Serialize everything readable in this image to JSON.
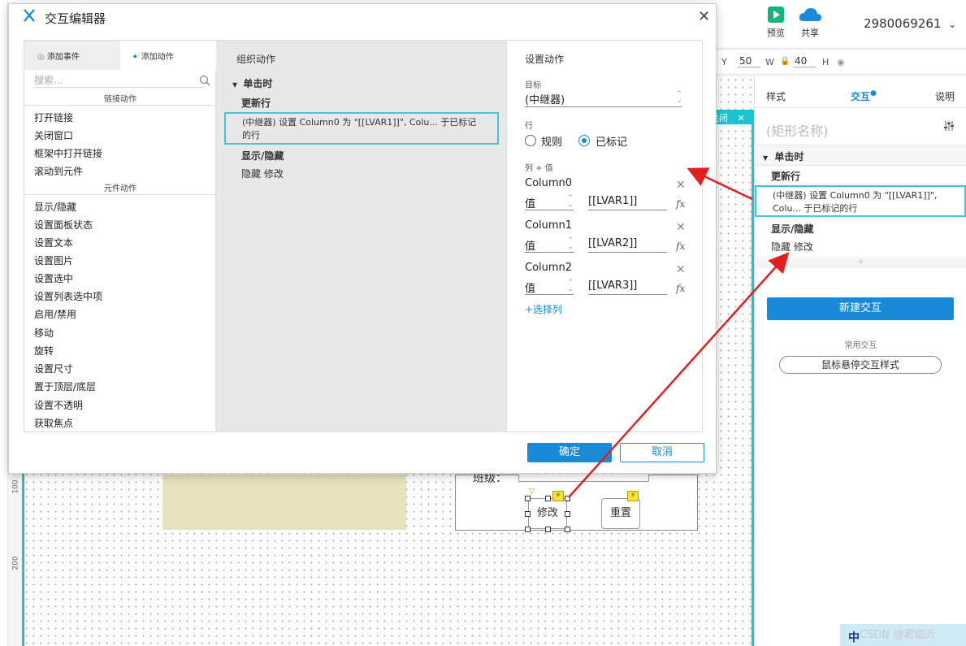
{
  "app": {
    "toolbar": {
      "preview_label": "预览",
      "share_label": "共享",
      "account": "2980069261"
    },
    "props": {
      "y_label": "Y",
      "w_label": "W",
      "w_value": "50",
      "h_value": "40",
      "h_label": "H"
    },
    "canvas": {
      "close_label": "关闭",
      "ruler_100": "100",
      "ruler_200": "200",
      "class_label": "班级：",
      "modify_label": "修改",
      "reset_label": "重置"
    },
    "right_panel": {
      "tab_style": "样式",
      "tab_interact": "交互",
      "tab_notes": "说明",
      "shape_name_placeholder": "(矩形名称)",
      "event": "单击时",
      "update_row": "更新行",
      "action_desc": "(中继器) 设置 Column0 为 \"[[LVAR1]]\", Colu... 于已标记的行",
      "show_hide": "显示/隐藏",
      "hide_modify": "隐藏 修改",
      "add_symbol": "+",
      "new_interaction": "新建交互",
      "common_label": "常用交互",
      "hover_style": "鼠标悬停交互样式"
    }
  },
  "dialog": {
    "title": "交互编辑器",
    "left": {
      "tab_add_event": "添加事件",
      "tab_add_action": "添加动作",
      "search_placeholder": "搜索...",
      "group_link": "链接动作",
      "link_actions": [
        "打开链接",
        "关闭窗口",
        "框架中打开链接",
        "滚动到元件"
      ],
      "group_widget": "元件动作",
      "widget_actions": [
        "显示/隐藏",
        "设置面板状态",
        "设置文本",
        "设置图片",
        "设置选中",
        "设置列表选中项",
        "启用/禁用",
        "移动",
        "旋转",
        "设置尺寸",
        "置于顶层/底层",
        "设置不透明",
        "获取焦点"
      ]
    },
    "middle": {
      "title": "组织动作",
      "event": "单击时",
      "update_row": "更新行",
      "action_desc": "(中继器) 设置 Column0 为 \"[[LVAR1]]\", Colu... 于已标记的行",
      "show_hide": "显示/隐藏",
      "hide_modify": "隐藏 修改"
    },
    "right": {
      "title": "设置动作",
      "target_label": "目标",
      "target_value": "(中继器)",
      "row_label": "行",
      "radio_rule": "规则",
      "radio_marked": "已标记",
      "selected_radio": "已标记",
      "colval_label": "列 + 值",
      "columns": [
        {
          "name": "Column0",
          "type": "值",
          "value": "[[LVAR1]]"
        },
        {
          "name": "Column1",
          "type": "值",
          "value": "[[LVAR2]]"
        },
        {
          "name": "Column2",
          "type": "值",
          "value": "[[LVAR3]]"
        }
      ],
      "select_columns_link": "+选择列"
    },
    "ok_label": "确定",
    "cancel_label": "取消"
  },
  "watermark": "CSDN @君临沂",
  "ime": "中",
  "colors": {
    "accent": "#1a8ad6",
    "highlight": "#40c8d6",
    "arrow": "#e02020"
  }
}
